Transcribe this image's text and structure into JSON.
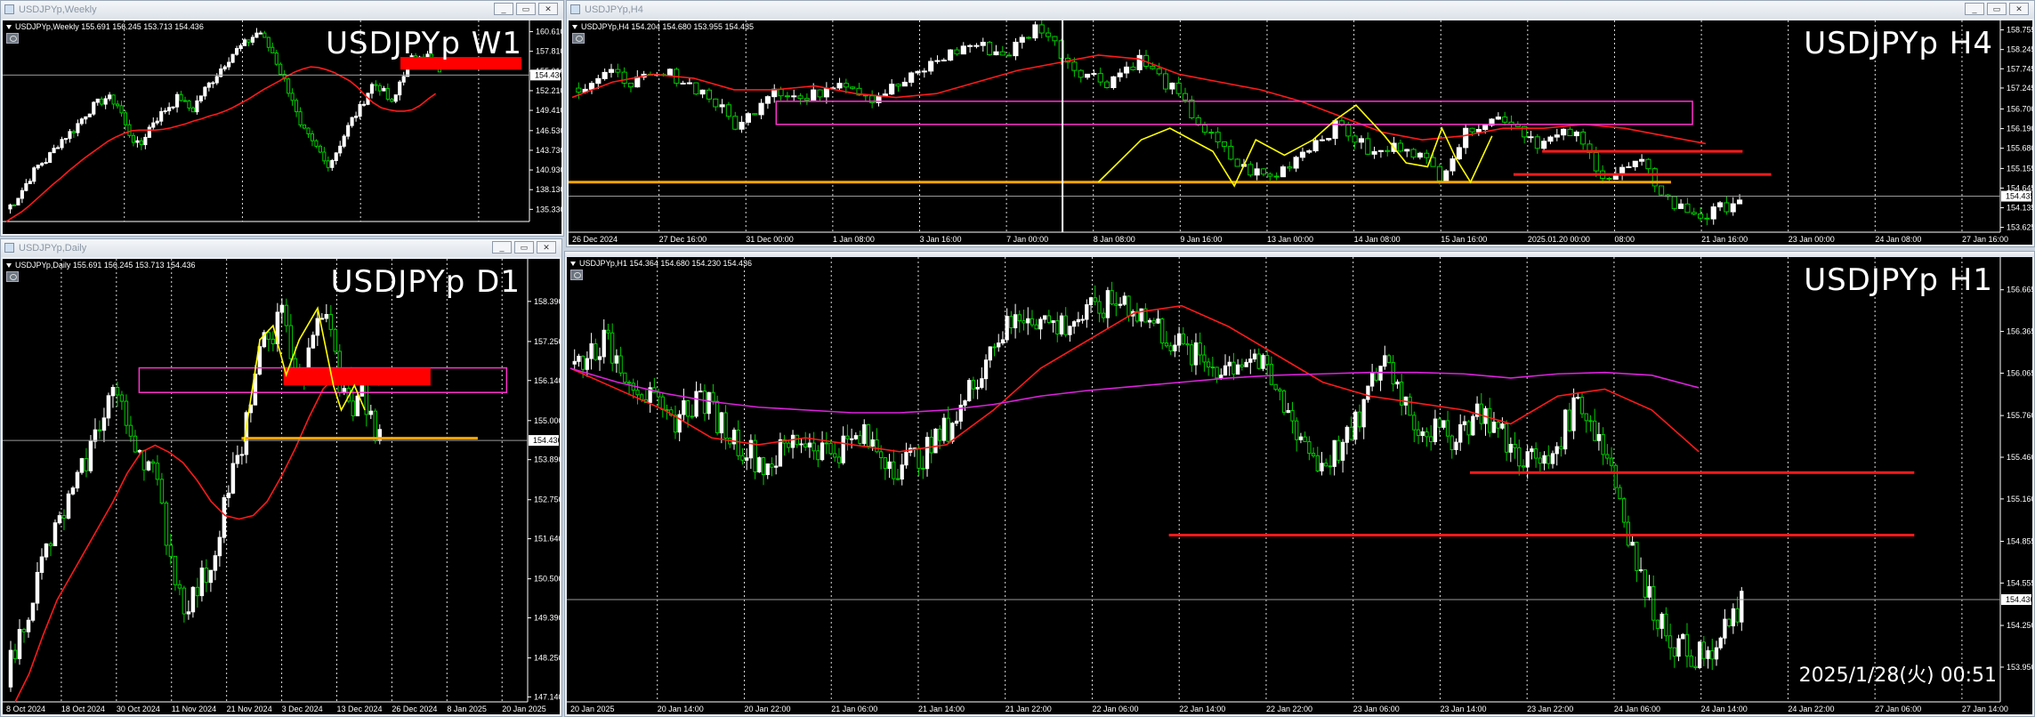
{
  "windows": [
    {
      "id": "w1",
      "title": "USDJPYp,Weekly",
      "info": "USDJPYp,Weekly  155.691 156.245 153.713 154.436",
      "big_label": "USDJPYp W1",
      "clock": "",
      "colors": {
        "up": "#ffffff",
        "down": "#00cc00",
        "ma1": "#ff1a1a",
        "ma2": "",
        "zone_fill": "#ff0000"
      }
    },
    {
      "id": "h4",
      "title": "USDJPYp,H4",
      "info": "USDJPYp,H4  154.204 154.680 153.955 154.435",
      "big_label": "USDJPYp H4",
      "clock": "",
      "colors": {
        "up": "#ffffff",
        "down": "#00cc00",
        "ma1": "#ff1a1a",
        "ma2": "",
        "zone": "#ff33cc",
        "support": "#ffa500",
        "path": "#ffff00"
      }
    },
    {
      "id": "d1",
      "title": "USDJPYp,Daily",
      "info": "USDJPYp,Daily  155.691 156.245 153.713 154.436",
      "big_label": "USDJPYp D1",
      "clock": "",
      "colors": {
        "up": "#ffffff",
        "down": "#00cc00",
        "ma1": "#ff1a1a",
        "zone": "#ff33cc",
        "support": "#ffa500",
        "path": "#ffff00"
      }
    },
    {
      "id": "h1",
      "title": "USDJPYp,H1",
      "info": "USDJPYp,H1  154.364 154.680 154.230 154.436",
      "big_label": "USDJPYp H1",
      "clock": "2025/1/28(火) 00:51",
      "colors": {
        "up": "#ffffff",
        "down": "#00cc00",
        "ma1": "#ff1a1a",
        "ma2": "#dd22dd"
      }
    }
  ],
  "chart_data": [
    {
      "type": "candlestick",
      "title": "USDJPYp W1",
      "ylim": [
        133.6,
        162.2
      ],
      "y_ticks": [
        "160.610",
        "157.810",
        "155.010",
        "152.210",
        "149.410",
        "146.530",
        "143.730",
        "140.930",
        "138.130",
        "135.330"
      ],
      "current_price": "154.436",
      "x_ticks": [
        "",
        "",
        "",
        "",
        ""
      ],
      "close_path": [
        135.4,
        136.2,
        137.5,
        139.0,
        140.5,
        141.8,
        142.3,
        143.6,
        145.0,
        145.8,
        146.5,
        147.8,
        149.0,
        149.9,
        150.6,
        151.2,
        150.8,
        149.9,
        146.8,
        145.4,
        144.0,
        146.2,
        147.8,
        148.6,
        149.7,
        150.4,
        151.5,
        150.0,
        149.5,
        151.3,
        152.6,
        153.8,
        155.1,
        156.4,
        157.5,
        158.3,
        159.0,
        159.9,
        160.8,
        158.9,
        157.6,
        155.2,
        153.0,
        151.0,
        147.0,
        146.0,
        144.5,
        143.5,
        141.6,
        142.6,
        144.5,
        146.5,
        148.3,
        149.5,
        151.6,
        153.2,
        152.8,
        151.4,
        150.0,
        153.4,
        155.5,
        156.9,
        157.6,
        157.3,
        156.5,
        154.4
      ],
      "ma_path": [
        133.6,
        134.3,
        135.0,
        135.9,
        136.9,
        137.9,
        138.9,
        139.8,
        140.8,
        141.7,
        142.6,
        143.4,
        144.2,
        145.0,
        145.6,
        146.1,
        146.5,
        146.6,
        146.6,
        146.6,
        146.7,
        146.9,
        147.2,
        147.5,
        147.9,
        148.2,
        148.6,
        148.9,
        149.3,
        149.8,
        150.4,
        151.0,
        151.7,
        152.4,
        153.0,
        153.6,
        154.3,
        154.9,
        155.3,
        155.6,
        155.5,
        155.2,
        154.8,
        154.2,
        153.6,
        152.7,
        151.5,
        150.5,
        149.8,
        149.5,
        149.3,
        149.3,
        149.5,
        150.1,
        151.0,
        151.8
      ],
      "zone": [
        155.2,
        157.0
      ]
    },
    {
      "type": "candlestick",
      "title": "USDJPYp H4",
      "ylim": [
        153.5,
        159.0
      ],
      "y_ticks": [
        "158.755",
        "158.245",
        "157.745",
        "157.245",
        "156.700",
        "156.190",
        "155.680",
        "155.155",
        "154.645",
        "154.135",
        "153.625"
      ],
      "current_price": "154.435",
      "x_ticks": [
        "26 Dec 2024",
        "27 Dec 16:00",
        "31 Dec 00:00",
        "1 Jan 08:00",
        "3 Jan 16:00",
        "7 Jan 00:00",
        "8 Jan 08:00",
        "9 Jan 16:00",
        "13 Jan 00:00",
        "14 Jan 08:00",
        "15 Jan 16:00",
        "2025.01.20 00:00",
        "08:00",
        "21 Jan 16:00",
        "23 Jan 00:00",
        "24 Jan 08:00",
        "27 Jan 16:00"
      ],
      "zone": [
        156.3,
        156.9
      ],
      "support": 154.8,
      "resistance_lines": [
        155.6,
        155.0
      ]
    },
    {
      "type": "candlestick",
      "title": "USDJPYp D1",
      "ylim": [
        147.0,
        159.6
      ],
      "y_ticks": [
        "158.390",
        "157.250",
        "156.140",
        "155.000",
        "153.890",
        "152.750",
        "151.640",
        "150.500",
        "149.390",
        "148.250",
        "147.140"
      ],
      "current_price": "154.436",
      "x_ticks": [
        "8 Oct 2024",
        "18 Oct 2024",
        "30 Oct 2024",
        "11 Nov 2024",
        "21 Nov 2024",
        "3 Dec 2024",
        "13 Dec 2024",
        "26 Dec 2024",
        "8 Jan 2025",
        "20 Jan 2025"
      ],
      "zone": [
        155.8,
        156.5
      ],
      "support": 154.5
    },
    {
      "type": "candlestick",
      "title": "USDJPYp H1",
      "ylim": [
        153.7,
        156.9
      ],
      "y_ticks": [
        "156.665",
        "156.365",
        "156.065",
        "155.760",
        "155.460",
        "155.160",
        "154.855",
        "154.555",
        "154.250",
        "153.950"
      ],
      "current_price": "154.436",
      "x_ticks": [
        "20 Jan 2025",
        "20 Jan 14:00",
        "20 Jan 22:00",
        "21 Jan 06:00",
        "21 Jan 14:00",
        "21 Jan 22:00",
        "22 Jan 06:00",
        "22 Jan 14:00",
        "22 Jan 22:00",
        "23 Jan 06:00",
        "23 Jan 14:00",
        "23 Jan 22:00",
        "24 Jan 06:00",
        "24 Jan 14:00",
        "24 Jan 22:00",
        "27 Jan 06:00",
        "27 Jan 14:00"
      ],
      "resistance_lines": [
        155.35,
        154.9
      ]
    }
  ]
}
